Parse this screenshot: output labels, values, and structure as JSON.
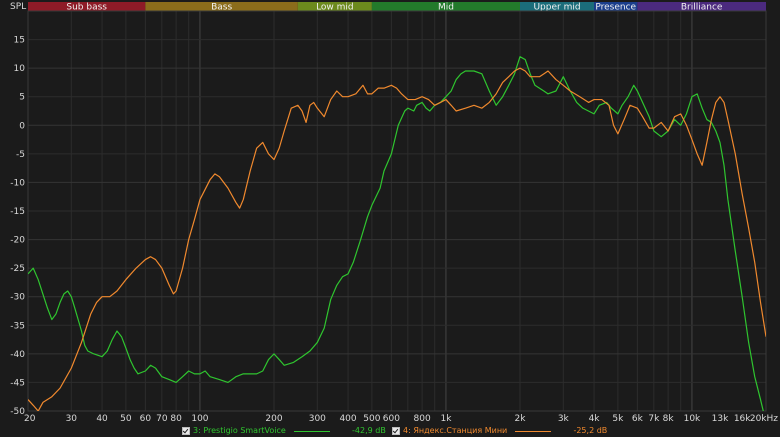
{
  "colors": {
    "background": "#1b1b1b",
    "grid_minor": "#2c2c2c",
    "grid_major": "#444444",
    "text": "#d8d8d8"
  },
  "bands": [
    {
      "label": "Sub bass",
      "from": 20,
      "to": 60,
      "color": "#8e1b27"
    },
    {
      "label": "Bass",
      "from": 60,
      "to": 250,
      "color": "#8b6d1b"
    },
    {
      "label": "Low mid",
      "from": 250,
      "to": 500,
      "color": "#6c8a1d"
    },
    {
      "label": "Mid",
      "from": 500,
      "to": 2000,
      "color": "#237a2b"
    },
    {
      "label": "Upper mid",
      "from": 2000,
      "to": 4000,
      "color": "#1b6d7a"
    },
    {
      "label": "Presence",
      "from": 4000,
      "to": 6000,
      "color": "#1b3e8c"
    },
    {
      "label": "Brilliance",
      "from": 6000,
      "to": 20000,
      "color": "#4b2a7e"
    }
  ],
  "chart_data": {
    "type": "line",
    "ylabel": "SPL",
    "xscale": "log",
    "xlim": [
      20,
      20000
    ],
    "ylim": [
      -50,
      20
    ],
    "grid": true,
    "x_ticks": [
      {
        "v": 20,
        "label": "20"
      },
      {
        "v": 30,
        "label": "30"
      },
      {
        "v": 40,
        "label": "40"
      },
      {
        "v": 50,
        "label": "50"
      },
      {
        "v": 60,
        "label": "60"
      },
      {
        "v": 70,
        "label": "70"
      },
      {
        "v": 80,
        "label": "80"
      },
      {
        "v": 100,
        "label": "100"
      },
      {
        "v": 200,
        "label": "200"
      },
      {
        "v": 300,
        "label": "300"
      },
      {
        "v": 400,
        "label": "400"
      },
      {
        "v": 500,
        "label": "500"
      },
      {
        "v": 600,
        "label": "600"
      },
      {
        "v": 800,
        "label": "800"
      },
      {
        "v": 1000,
        "label": "1k"
      },
      {
        "v": 2000,
        "label": "2k"
      },
      {
        "v": 3000,
        "label": "3k"
      },
      {
        "v": 4000,
        "label": "4k"
      },
      {
        "v": 5000,
        "label": "5k"
      },
      {
        "v": 6000,
        "label": "6k"
      },
      {
        "v": 7000,
        "label": "7k"
      },
      {
        "v": 8000,
        "label": "8k"
      },
      {
        "v": 10000,
        "label": "10k"
      },
      {
        "v": 13000,
        "label": "13k"
      },
      {
        "v": 16000,
        "label": "16k"
      },
      {
        "v": 20000,
        "label": "20kHz"
      }
    ],
    "y_ticks": [
      15,
      10,
      5,
      0,
      -5,
      -10,
      -15,
      -20,
      -25,
      -30,
      -35,
      -40,
      -45,
      -50
    ],
    "series": [
      {
        "name": "3: Prestigio SmartVoice",
        "value_label": "-42,9 dB",
        "color": "#2fc52f",
        "points": [
          [
            20,
            -26
          ],
          [
            21,
            -25
          ],
          [
            22,
            -27
          ],
          [
            24,
            -32
          ],
          [
            25,
            -34
          ],
          [
            26,
            -33
          ],
          [
            27,
            -31
          ],
          [
            28,
            -29.5
          ],
          [
            29,
            -29
          ],
          [
            30,
            -30
          ],
          [
            31,
            -32
          ],
          [
            33,
            -36
          ],
          [
            34,
            -38.5
          ],
          [
            35,
            -39.5
          ],
          [
            37,
            -40
          ],
          [
            40,
            -40.5
          ],
          [
            42,
            -39.5
          ],
          [
            44,
            -37.5
          ],
          [
            46,
            -36
          ],
          [
            48,
            -37
          ],
          [
            50,
            -39
          ],
          [
            52,
            -41
          ],
          [
            54,
            -42.5
          ],
          [
            56,
            -43.5
          ],
          [
            60,
            -43
          ],
          [
            63,
            -42
          ],
          [
            66,
            -42.5
          ],
          [
            70,
            -44
          ],
          [
            75,
            -44.5
          ],
          [
            80,
            -45
          ],
          [
            85,
            -44
          ],
          [
            90,
            -43
          ],
          [
            95,
            -43.5
          ],
          [
            100,
            -43.5
          ],
          [
            105,
            -43
          ],
          [
            110,
            -44
          ],
          [
            120,
            -44.5
          ],
          [
            130,
            -45
          ],
          [
            140,
            -44
          ],
          [
            150,
            -43.5
          ],
          [
            160,
            -43.5
          ],
          [
            170,
            -43.5
          ],
          [
            180,
            -43
          ],
          [
            190,
            -41
          ],
          [
            200,
            -40
          ],
          [
            210,
            -41
          ],
          [
            220,
            -42
          ],
          [
            240,
            -41.5
          ],
          [
            260,
            -40.5
          ],
          [
            280,
            -39.5
          ],
          [
            300,
            -38
          ],
          [
            320,
            -35.5
          ],
          [
            340,
            -30.5
          ],
          [
            360,
            -28
          ],
          [
            380,
            -26.5
          ],
          [
            400,
            -26
          ],
          [
            420,
            -24
          ],
          [
            450,
            -20
          ],
          [
            480,
            -16
          ],
          [
            500,
            -14
          ],
          [
            540,
            -11
          ],
          [
            560,
            -8
          ],
          [
            600,
            -5
          ],
          [
            640,
            0
          ],
          [
            680,
            2.5
          ],
          [
            700,
            3
          ],
          [
            740,
            2.5
          ],
          [
            760,
            3.5
          ],
          [
            800,
            4
          ],
          [
            830,
            3
          ],
          [
            860,
            2.5
          ],
          [
            900,
            3.5
          ],
          [
            950,
            4
          ],
          [
            1000,
            5
          ],
          [
            1050,
            6
          ],
          [
            1100,
            8
          ],
          [
            1150,
            9
          ],
          [
            1200,
            9.5
          ],
          [
            1300,
            9.5
          ],
          [
            1400,
            9
          ],
          [
            1500,
            6
          ],
          [
            1600,
            3.5
          ],
          [
            1700,
            5
          ],
          [
            1800,
            7
          ],
          [
            1900,
            9
          ],
          [
            2000,
            12
          ],
          [
            2100,
            11.5
          ],
          [
            2200,
            9
          ],
          [
            2300,
            7
          ],
          [
            2500,
            6
          ],
          [
            2600,
            5.5
          ],
          [
            2800,
            6
          ],
          [
            3000,
            8.5
          ],
          [
            3200,
            6
          ],
          [
            3400,
            4
          ],
          [
            3600,
            3
          ],
          [
            4000,
            2
          ],
          [
            4200,
            3.5
          ],
          [
            4500,
            4
          ],
          [
            4700,
            3
          ],
          [
            5000,
            2
          ],
          [
            5200,
            3.5
          ],
          [
            5500,
            5
          ],
          [
            5800,
            7
          ],
          [
            6000,
            6
          ],
          [
            6300,
            4
          ],
          [
            6700,
            1.5
          ],
          [
            7000,
            -1
          ],
          [
            7500,
            -2
          ],
          [
            8000,
            -1
          ],
          [
            8500,
            1
          ],
          [
            9000,
            0
          ],
          [
            9500,
            2
          ],
          [
            10000,
            5
          ],
          [
            10500,
            5.5
          ],
          [
            11000,
            3
          ],
          [
            11500,
            1
          ],
          [
            12000,
            0.5
          ],
          [
            12500,
            -1
          ],
          [
            13000,
            -3
          ],
          [
            13500,
            -7
          ],
          [
            14000,
            -13
          ],
          [
            15000,
            -22
          ],
          [
            16000,
            -30
          ],
          [
            17000,
            -38
          ],
          [
            18000,
            -44
          ],
          [
            19000,
            -48
          ],
          [
            20000,
            -52
          ]
        ]
      },
      {
        "name": "4: Яндекс.Станция Мини",
        "value_label": "-25,2 dB",
        "color": "#f0892e",
        "points": [
          [
            20,
            -48
          ],
          [
            21,
            -49
          ],
          [
            22,
            -50
          ],
          [
            23,
            -48.5
          ],
          [
            25,
            -47.5
          ],
          [
            27,
            -46
          ],
          [
            30,
            -42.5
          ],
          [
            33,
            -38
          ],
          [
            36,
            -33
          ],
          [
            38,
            -31
          ],
          [
            40,
            -30
          ],
          [
            43,
            -30
          ],
          [
            46,
            -29
          ],
          [
            50,
            -27
          ],
          [
            55,
            -25
          ],
          [
            60,
            -23.5
          ],
          [
            63,
            -23
          ],
          [
            66,
            -23.5
          ],
          [
            70,
            -25
          ],
          [
            75,
            -28
          ],
          [
            78,
            -29.5
          ],
          [
            80,
            -29
          ],
          [
            85,
            -25
          ],
          [
            90,
            -20
          ],
          [
            95,
            -16.5
          ],
          [
            100,
            -13
          ],
          [
            110,
            -9.5
          ],
          [
            115,
            -8.5
          ],
          [
            120,
            -9
          ],
          [
            130,
            -11
          ],
          [
            140,
            -13.5
          ],
          [
            145,
            -14.5
          ],
          [
            150,
            -13
          ],
          [
            160,
            -8
          ],
          [
            170,
            -4
          ],
          [
            180,
            -3
          ],
          [
            190,
            -5
          ],
          [
            200,
            -6
          ],
          [
            210,
            -4
          ],
          [
            220,
            -1
          ],
          [
            235,
            3
          ],
          [
            250,
            3.5
          ],
          [
            260,
            2.5
          ],
          [
            270,
            0.5
          ],
          [
            280,
            3.5
          ],
          [
            290,
            4
          ],
          [
            300,
            3
          ],
          [
            320,
            1.5
          ],
          [
            340,
            4.5
          ],
          [
            360,
            6
          ],
          [
            380,
            5
          ],
          [
            400,
            5
          ],
          [
            430,
            5.5
          ],
          [
            460,
            7
          ],
          [
            480,
            5.5
          ],
          [
            500,
            5.5
          ],
          [
            530,
            6.5
          ],
          [
            560,
            6.5
          ],
          [
            600,
            7
          ],
          [
            630,
            6.5
          ],
          [
            660,
            5.5
          ],
          [
            700,
            4.5
          ],
          [
            750,
            4.5
          ],
          [
            800,
            5
          ],
          [
            850,
            4.5
          ],
          [
            900,
            3.5
          ],
          [
            950,
            4
          ],
          [
            1000,
            4.5
          ],
          [
            1050,
            3.5
          ],
          [
            1100,
            2.5
          ],
          [
            1200,
            3
          ],
          [
            1300,
            3.5
          ],
          [
            1400,
            3
          ],
          [
            1500,
            4
          ],
          [
            1600,
            5.5
          ],
          [
            1700,
            7.5
          ],
          [
            1800,
            8.5
          ],
          [
            1900,
            9.5
          ],
          [
            2000,
            10
          ],
          [
            2100,
            9.5
          ],
          [
            2200,
            8.5
          ],
          [
            2400,
            8.5
          ],
          [
            2500,
            9
          ],
          [
            2600,
            9.5
          ],
          [
            2800,
            8
          ],
          [
            3000,
            7
          ],
          [
            3200,
            6
          ],
          [
            3500,
            5
          ],
          [
            3800,
            4
          ],
          [
            4000,
            4.5
          ],
          [
            4300,
            4.5
          ],
          [
            4600,
            3.5
          ],
          [
            4800,
            0
          ],
          [
            5000,
            -1.5
          ],
          [
            5300,
            1
          ],
          [
            5600,
            3.5
          ],
          [
            6000,
            3
          ],
          [
            6300,
            1.5
          ],
          [
            6700,
            -0.5
          ],
          [
            7000,
            -0.5
          ],
          [
            7500,
            0.5
          ],
          [
            8000,
            -1
          ],
          [
            8500,
            1.5
          ],
          [
            9000,
            2
          ],
          [
            9500,
            0
          ],
          [
            10000,
            -2.5
          ],
          [
            10500,
            -5
          ],
          [
            11000,
            -7
          ],
          [
            11500,
            -3
          ],
          [
            12000,
            1
          ],
          [
            12500,
            4
          ],
          [
            13000,
            5
          ],
          [
            13500,
            4
          ],
          [
            14000,
            1
          ],
          [
            15000,
            -5
          ],
          [
            16000,
            -12
          ],
          [
            17000,
            -18
          ],
          [
            18000,
            -24
          ],
          [
            19000,
            -31
          ],
          [
            20000,
            -37
          ]
        ]
      }
    ]
  }
}
